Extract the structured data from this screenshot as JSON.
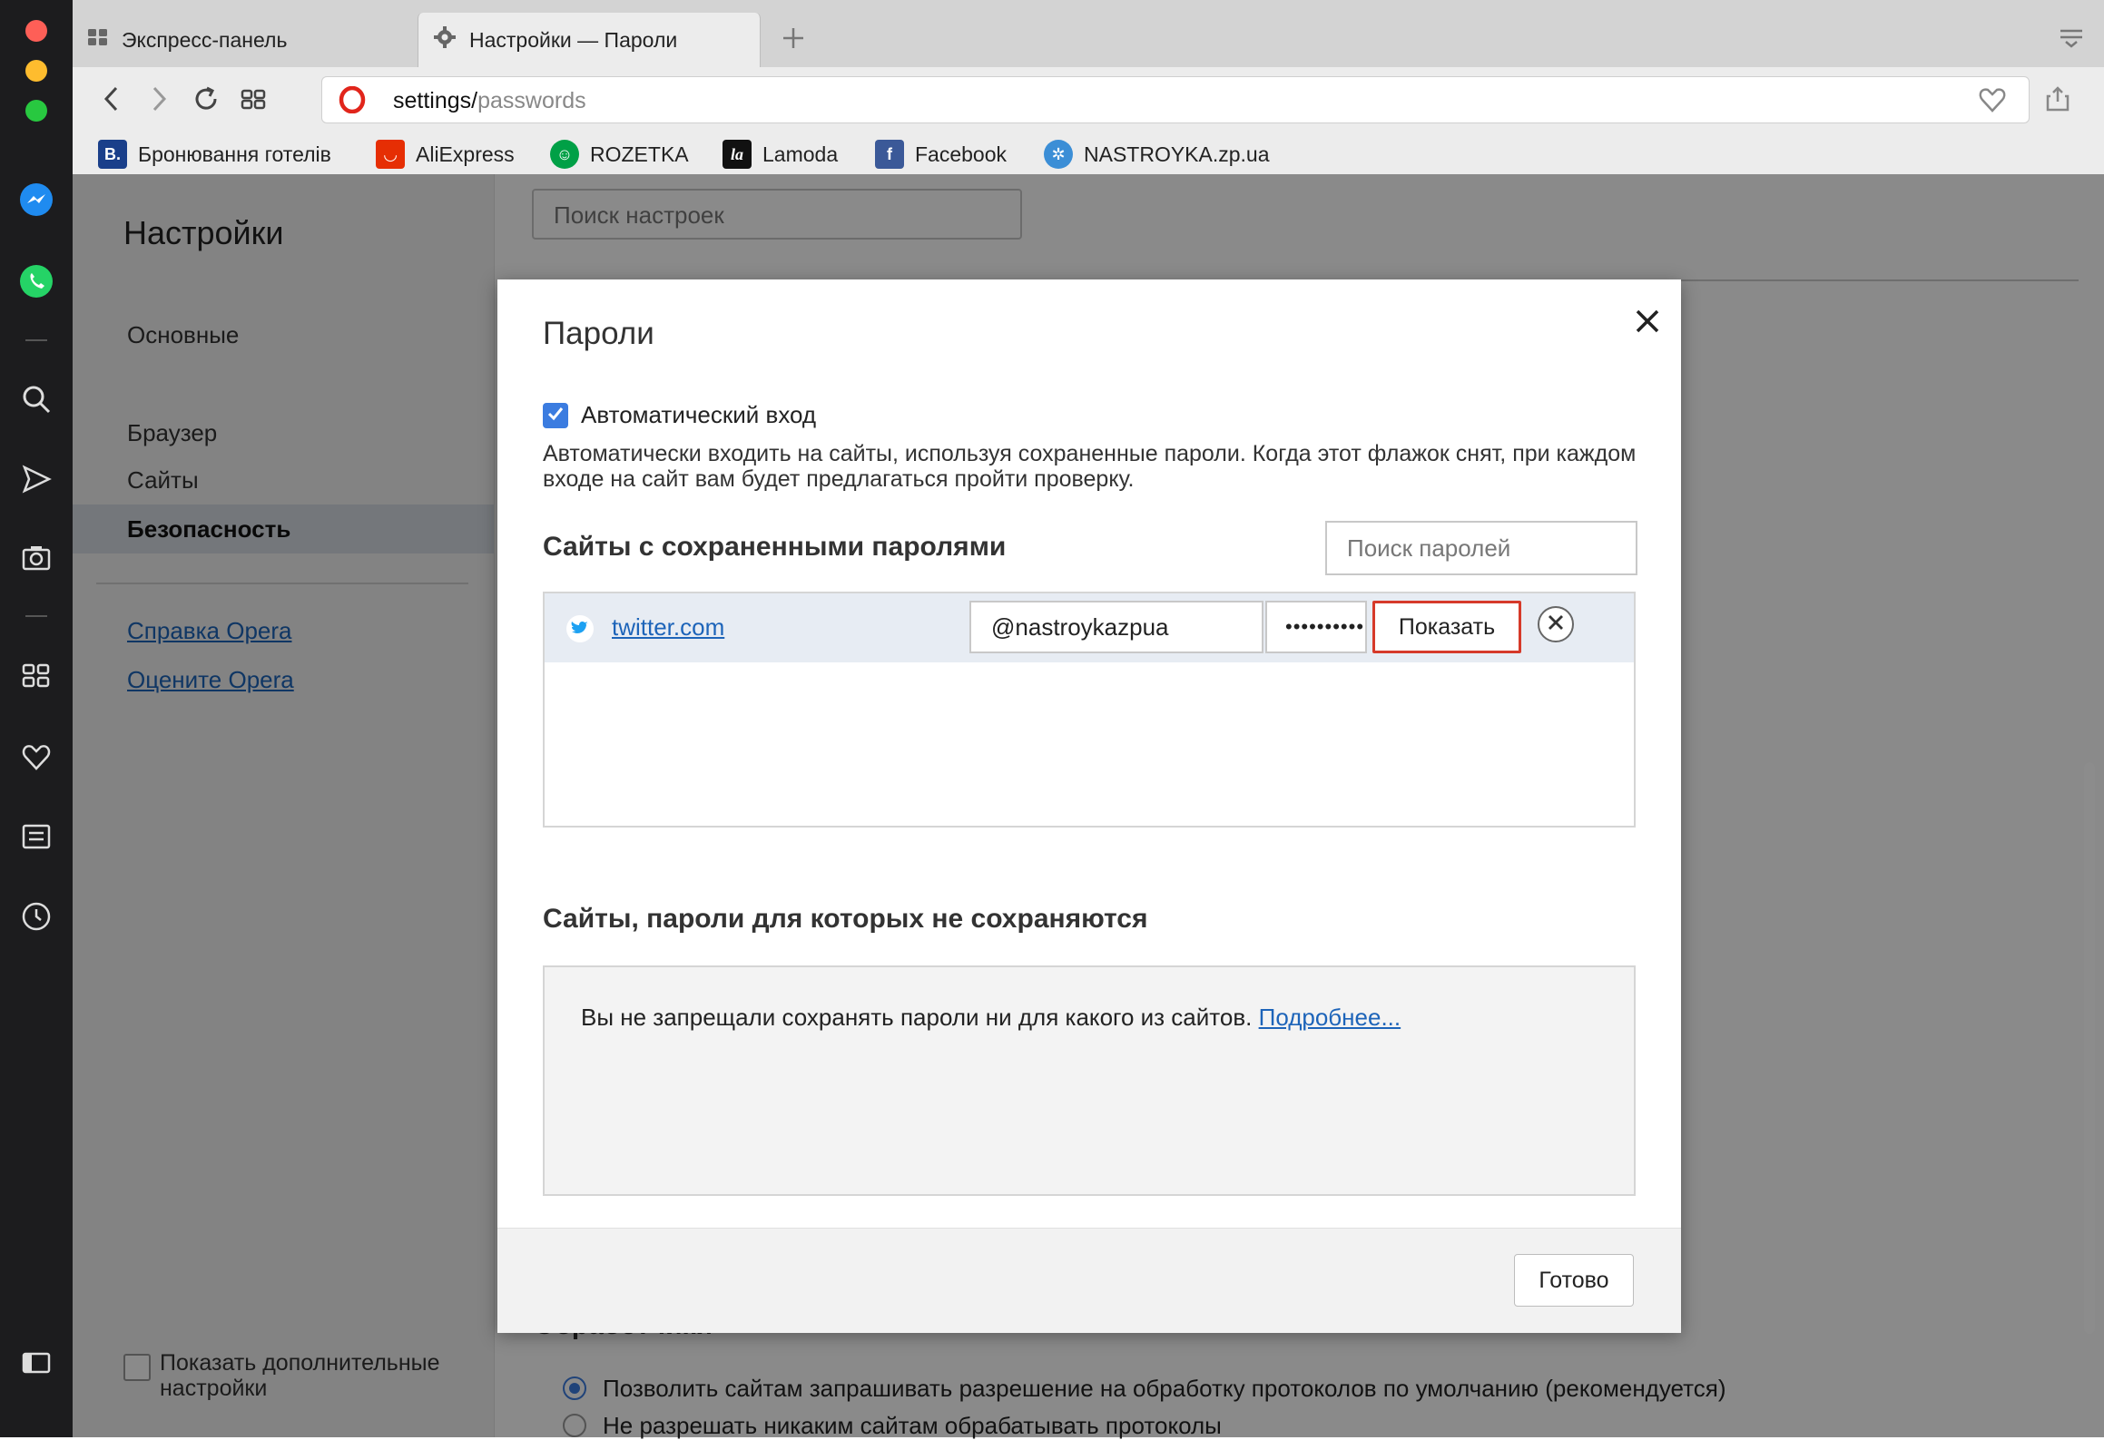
{
  "tabs": [
    {
      "label": "Экспресс-панель",
      "icon": "speed-dial-icon"
    },
    {
      "label": "Настройки — Пароли",
      "icon": "gear-icon"
    }
  ],
  "address": {
    "host": "settings/",
    "path": "passwords"
  },
  "bookmarks": [
    {
      "label": "Бронювання готелів",
      "icon": "booking-icon",
      "glyph": "B.",
      "color": "#1a3f8a"
    },
    {
      "label": "AliExpress",
      "icon": "aliexpress-icon",
      "glyph": "◡",
      "color": "#e62e04"
    },
    {
      "label": "ROZETKA",
      "icon": "rozetka-icon",
      "glyph": "☺",
      "color": "#00a046"
    },
    {
      "label": "Lamoda",
      "icon": "lamoda-icon",
      "glyph": "la",
      "color": "#111111"
    },
    {
      "label": "Facebook",
      "icon": "facebook-icon",
      "glyph": "f",
      "color": "#3b5998"
    },
    {
      "label": "NASTROYKA.zp.ua",
      "icon": "nastroyka-icon",
      "glyph": "✲",
      "color": "#3b8ed6"
    }
  ],
  "settings": {
    "title": "Настройки",
    "search_placeholder": "Поиск настроек",
    "nav": [
      "Основные",
      "Браузер",
      "Сайты",
      "Безопасность"
    ],
    "links": [
      "Справка Opera",
      "Оцените Opera"
    ],
    "show_advanced": "Показать дополнительные настройки",
    "bg_partial_heading": "Обработчики",
    "radio_1": "Позволить сайтам запрашивать разрешение на обработку протоколов по умолчанию (рекомендуется)",
    "radio_2": "Не разрешать никаким сайтам обрабатывать протоколы"
  },
  "dialog": {
    "title": "Пароли",
    "autologin_label": "Автоматический вход",
    "autologin_checked": true,
    "autologin_desc": "Автоматически входить на сайты, используя сохраненные пароли. Когда этот флажок снят, при каждом входе на сайт вам будет предлагаться пройти проверку.",
    "saved_heading": "Сайты с сохраненными паролями",
    "search_passwords_placeholder": "Поиск паролей",
    "entries": [
      {
        "site": "twitter.com",
        "username": "@nastroykazpua",
        "password_mask": "••••••••••",
        "show_label": "Показать"
      }
    ],
    "never_heading": "Сайты, пароли для которых не сохраняются",
    "never_text": "Вы не запрещали сохранять пароли ни для какого из сайтов.",
    "never_link": "Подробнее...",
    "done_label": "Готово"
  },
  "colors": {
    "accent_blue": "#3b7ce0",
    "highlight_red": "#d63a2a",
    "link": "#1d64b9"
  }
}
